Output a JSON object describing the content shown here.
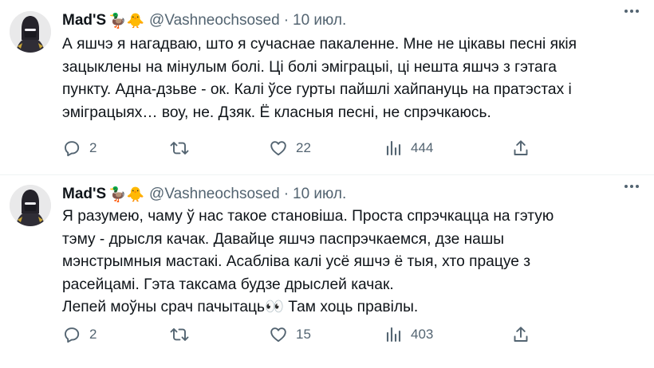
{
  "tweets": [
    {
      "author": {
        "name": "Mad'S",
        "emoji": "🦆🐥",
        "handle": "@Vashneochsosed"
      },
      "date": "10 июл.",
      "text": "А яшчэ я нагадваю, што я сучаснае пакаленне. Мне не цікавы песні якія\nзацыклены на мінулым болі. Ці болі эміграцыі, ці нешта яшчэ з гэтага\nпункту. Адна-дзьве - ок. Калі ўсе гурты пайшлі хайпануць на пратэстах і\nэміграцыях… воу, не. Дзяк. Ё класныя песні, не спрэчкаюсь.",
      "stats": {
        "replies": "2",
        "likes": "22",
        "views": "444"
      }
    },
    {
      "author": {
        "name": "Mad'S",
        "emoji": "🦆🐥",
        "handle": "@Vashneochsosed"
      },
      "date": "10 июл.",
      "text": "Я разумею, чаму ў нас такое становіша. Проста спрэчкацца на гэтую\nтэму - дрысля качак. Давайце яшчэ паспрэчкаемся, дзе нашы\nмэнстрымныя мастакі. Асабліва калі усё яшчэ ё тыя, хто працуе з\nрасейцамі. Гэта таксама будзе дрыслей качак.\nЛепей моўны срач пачытаць👀 Там хоць правілы.",
      "stats": {
        "replies": "2",
        "likes": "15",
        "views": "403"
      }
    }
  ],
  "icons": {
    "reply": "reply-icon",
    "retweet": "retweet-icon",
    "like": "like-icon",
    "views": "views-icon",
    "share": "share-icon",
    "more": "more-icon"
  },
  "colors": {
    "text": "#0f1419",
    "secondary": "#536471",
    "divider": "#eff3f4"
  }
}
